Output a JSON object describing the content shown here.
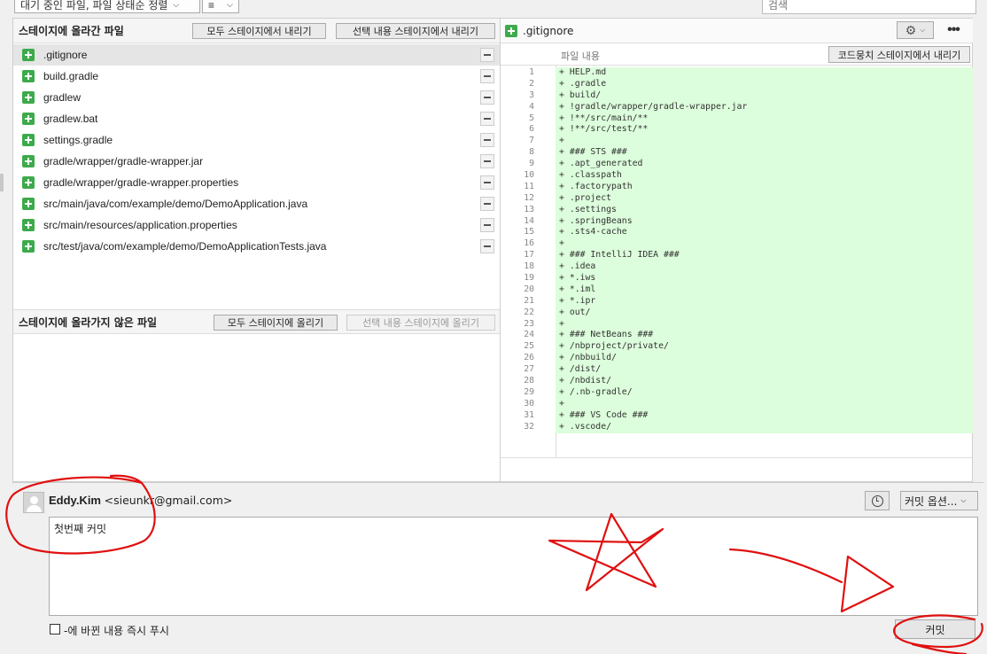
{
  "toolbar": {
    "sort_dropdown": "대기 중인 파일, 파일 상태순 정렬",
    "view_dropdown_icon": "≡",
    "search_placeholder": "검색"
  },
  "staged": {
    "title": "스테이지에 올라간 파일",
    "unstage_all": "모두 스테이지에서 내리기",
    "unstage_selected": "선택 내용 스테이지에서 내리기",
    "files": [
      ".gitignore",
      "build.gradle",
      "gradlew",
      "gradlew.bat",
      "settings.gradle",
      "gradle/wrapper/gradle-wrapper.jar",
      "gradle/wrapper/gradle-wrapper.properties",
      "src/main/java/com/example/demo/DemoApplication.java",
      "src/main/resources/application.properties",
      "src/test/java/com/example/demo/DemoApplicationTests.java"
    ]
  },
  "unstaged": {
    "title": "스테이지에 올라가지 않은 파일",
    "stage_all": "모두 스테이지에 올리기",
    "stage_selected": "선택 내용 스테이지에 올리기"
  },
  "diff": {
    "filename": ".gitignore",
    "content_label": "파일 내용",
    "unstage_hunk": "코드뭉치 스테이지에서 내리기",
    "lines": [
      "HELP.md",
      ".gradle",
      "build/",
      "!gradle/wrapper/gradle-wrapper.jar",
      "!**/src/main/**",
      "!**/src/test/**",
      "",
      "### STS ###",
      ".apt_generated",
      ".classpath",
      ".factorypath",
      ".project",
      ".settings",
      ".springBeans",
      ".sts4-cache",
      "",
      "### IntelliJ IDEA ###",
      ".idea",
      "*.iws",
      "*.iml",
      "*.ipr",
      "out/",
      "",
      "### NetBeans ###",
      "/nbproject/private/",
      "/nbbuild/",
      "/dist/",
      "/nbdist/",
      "/.nb-gradle/",
      "",
      "### VS Code ###",
      ".vscode/"
    ],
    "line_prefix": "+"
  },
  "commit": {
    "author_name": "Eddy.Kim",
    "author_email": "<sieunkr@gmail.com>",
    "commit_options": "커밋 옵션...",
    "message": "첫번째 커밋",
    "push_label": "-에 바뀐 내용 즉시 푸시",
    "commit_button": "커밋"
  },
  "colors": {
    "annotation": "#e01010",
    "added_bg": "#dcfedc",
    "add_icon": "#3daa4b"
  }
}
